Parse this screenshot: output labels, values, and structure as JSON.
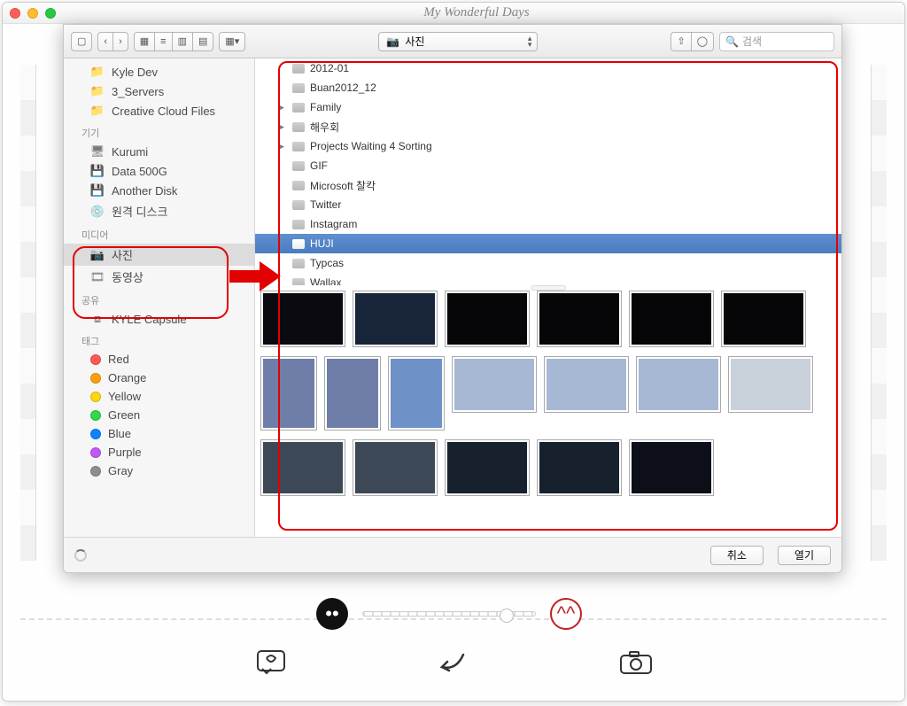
{
  "app": {
    "title": "My Wonderful Days"
  },
  "toolbar": {
    "path_label": "사진",
    "search_placeholder": "검색"
  },
  "sidebar": {
    "favorites": [
      {
        "label": "Kyle Dev",
        "icon": "folder"
      },
      {
        "label": "3_Servers",
        "icon": "folder"
      },
      {
        "label": "Creative Cloud Files",
        "icon": "folder"
      }
    ],
    "devices_header": "기기",
    "devices": [
      {
        "label": "Kurumi",
        "icon": "display"
      },
      {
        "label": "Data 500G",
        "icon": "hdd"
      },
      {
        "label": "Another Disk",
        "icon": "hdd"
      },
      {
        "label": "원격 디스크",
        "icon": "disc"
      }
    ],
    "media_header": "미디어",
    "media": [
      {
        "label": "사진",
        "icon": "camera",
        "selected": true
      },
      {
        "label": "동영상",
        "icon": "film"
      }
    ],
    "shared_header": "공유",
    "shared": [
      {
        "label": "KYLE Capsule",
        "icon": "capsule"
      }
    ],
    "tags_header": "태그",
    "tags": [
      {
        "label": "Red",
        "color": "#ff5a52"
      },
      {
        "label": "Orange",
        "color": "#ff9f0a"
      },
      {
        "label": "Yellow",
        "color": "#ffd60a"
      },
      {
        "label": "Green",
        "color": "#32d74b"
      },
      {
        "label": "Blue",
        "color": "#0a84ff"
      },
      {
        "label": "Purple",
        "color": "#bf5af2"
      },
      {
        "label": "Gray",
        "color": "#8e8e93"
      }
    ]
  },
  "folders": [
    {
      "label": "2012-01",
      "indent": 1
    },
    {
      "label": "Buan2012_12",
      "indent": 1
    },
    {
      "label": "Family",
      "indent": 1,
      "tri": true
    },
    {
      "label": "해우회",
      "indent": 1,
      "tri": true
    },
    {
      "label": "Projects Waiting 4 Sorting",
      "indent": 1,
      "tri": true
    },
    {
      "label": "GIF",
      "indent": 1
    },
    {
      "label": "Microsoft 찰칵",
      "indent": 1
    },
    {
      "label": "Twitter",
      "indent": 1
    },
    {
      "label": "Instagram",
      "indent": 1
    },
    {
      "label": "HUJI",
      "indent": 1,
      "selected": true
    },
    {
      "label": "Typcas",
      "indent": 1
    },
    {
      "label": "Wallax",
      "indent": 1
    }
  ],
  "footer": {
    "cancel": "취소",
    "open": "열기"
  },
  "thumbs": [
    {
      "c": "#0a0a10"
    },
    {
      "c": "#18243a"
    },
    {
      "c": "#060608"
    },
    {
      "c": "#060608"
    },
    {
      "c": "#060608"
    },
    {
      "c": "#060608"
    },
    {
      "c": "#6e7ea8",
      "tall": true
    },
    {
      "c": "#6e7ea8",
      "tall": true
    },
    {
      "c": "#6e92c8",
      "tall": true
    },
    {
      "c": "#a7b8d4"
    },
    {
      "c": "#a7b8d4"
    },
    {
      "c": "#a7b8d4"
    },
    {
      "c": "#c9d1db"
    },
    {
      "c": "#3d4856"
    },
    {
      "c": "#3d4856"
    },
    {
      "c": "#17212e"
    },
    {
      "c": "#17212e"
    },
    {
      "c": "#0c0f18"
    }
  ]
}
